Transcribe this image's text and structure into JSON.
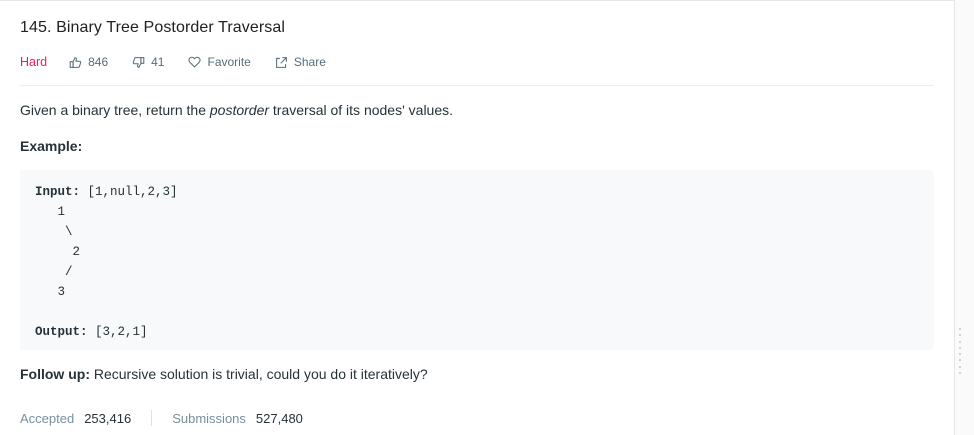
{
  "problem": {
    "title": "145. Binary Tree Postorder Traversal",
    "difficulty": "Hard",
    "likes": "846",
    "dislikes": "41",
    "favorite_label": "Favorite",
    "share_label": "Share"
  },
  "description": {
    "before": "Given a binary tree, return the ",
    "emphasis": "postorder",
    "after": " traversal of its nodes' values."
  },
  "example": {
    "heading": "Example:",
    "input_label": "Input:",
    "input_value": " [1,null,2,3]",
    "tree_lines": [
      "   1",
      "    \\",
      "     2",
      "    /",
      "   3"
    ],
    "output_label": "Output:",
    "output_value": " [3,2,1]"
  },
  "follow_up": {
    "label": "Follow up:",
    "text": " Recursive solution is trivial, could you do it iteratively?"
  },
  "stats": {
    "accepted_label": "Accepted",
    "accepted_value": "253,416",
    "submissions_label": "Submissions",
    "submissions_value": "527,480"
  },
  "colors": {
    "difficulty_hard": "#e91e63",
    "meta_text": "#546e7a",
    "code_background": "#f7f9fa"
  },
  "icons": [
    "thumbs-up-icon",
    "thumbs-down-icon",
    "heart-icon",
    "share-icon"
  ]
}
